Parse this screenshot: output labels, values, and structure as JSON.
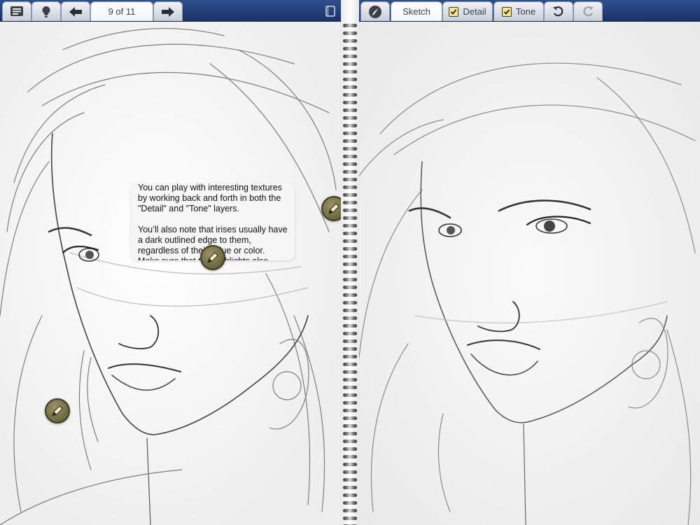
{
  "toolbar": {
    "page_indicator": "9 of 11",
    "tabs": {
      "sketch": "Sketch",
      "detail": "Detail",
      "tone": "Tone"
    },
    "icons": {
      "menu": "menu-icon",
      "hint": "lightbulb-icon",
      "prev": "arrow-left-icon",
      "next": "arrow-right-icon",
      "single_page": "single-page-icon",
      "brush": "brush-tool-icon",
      "undo": "undo-icon",
      "redo": "redo-icon"
    },
    "checked": {
      "detail": true,
      "tone": true
    }
  },
  "tooltip": {
    "text": "You can play with interesting textures by working back and forth in both the \"Detail\" and \"Tone\" layers.\n\nYou’ll also note that irises usually have a dark outlined edge to them, regardless of their value or color. Make sure that the highlights also"
  },
  "colors": {
    "toolbar": "#1f3a70",
    "marker": "#7a7450",
    "checkbox": "#f6e58d"
  }
}
